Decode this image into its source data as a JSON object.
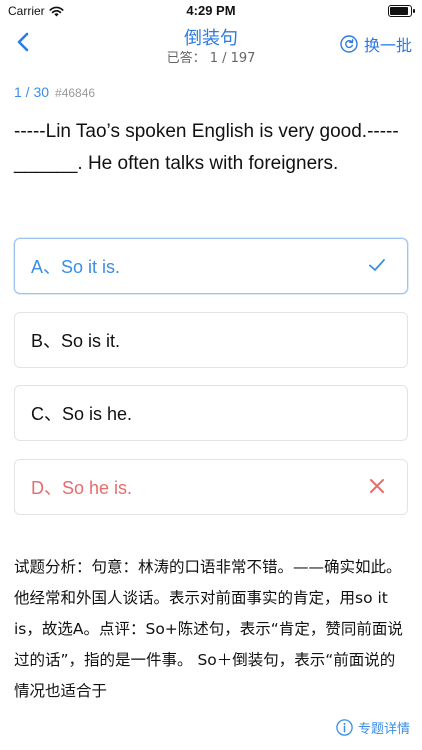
{
  "status": {
    "carrier": "Carrier",
    "time": "4:29 PM"
  },
  "nav": {
    "title": "倒装句",
    "subtitle": "已答： 1 / 197",
    "swap_label": "换一批"
  },
  "question": {
    "progress": "1 / 30",
    "id": "#46846",
    "text": "-----Lin Tao’s spoken English is very good.----- ______. He often talks with foreigners."
  },
  "options": [
    {
      "label": "A、So it is.",
      "state": "correct"
    },
    {
      "label": "B、So is it.",
      "state": "normal"
    },
    {
      "label": "C、So is he.",
      "state": "normal"
    },
    {
      "label": "D、So he is.",
      "state": "wrong"
    }
  ],
  "analysis": "试题分析：句意：林涛的口语非常不错。——确实如此。他经常和外国人谈话。表示对前面事实的肯定，用so it is，故选A。点评：So+陈述句，表示“肯定，赞同前面说过的话”，指的是一件事。 So＋倒装句，表示“前面说的情况也适合于",
  "footer": {
    "detail_label": "专题详情"
  },
  "colors": {
    "accent": "#2c7be5",
    "correct": "#3a8ee6",
    "wrong": "#e96b6b"
  }
}
